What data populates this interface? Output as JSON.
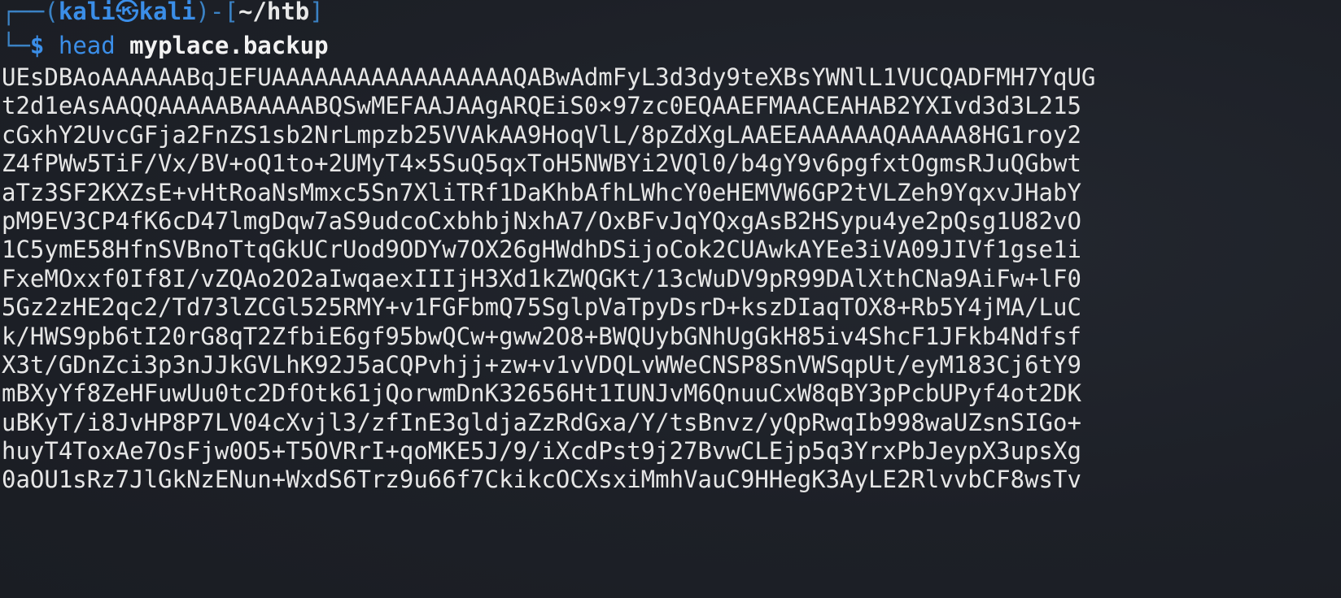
{
  "prompt": {
    "corner_top": "┌──(",
    "user": "kali",
    "at_symbol": "㉿",
    "host": "kali",
    "close_paren_bracket": ")-[",
    "cwd": "~/htb",
    "close_bracket": "]",
    "corner_bottom": "└─",
    "dollar": "$",
    "command": "head",
    "argument": "myplace.backup"
  },
  "output_lines": [
    "UEsDBAoAAAAAABqJEFUAAAAAAAAAAAAAAAAAQABwAdmFyL3d3dy9teXBsYWNlL1VUCQADFMH7YqUG",
    "t2d1eAsAAQQAAAAABAAAAABQSwMEFAAJAAgARQEiS0×97zc0EQAAEFMAACEAHAB2YXIvd3d3L215",
    "cGxhY2UvcGFja2FnZS1sb2NrLmpzb25VVAkAA9HoqVlL/8pZdXgLAAEEAAAAAAQAAAAA8HG1roy2",
    "Z4fPWw5TiF/Vx/BV+oQ1to+2UMyT4×5SuQ5qxToH5NWBYi2VQl0/b4gY9v6pgfxtOgmsRJuQGbwt",
    "aTz3SF2KXZsE+vHtRoaNsMmxc5Sn7XliTRf1DaKhbAfhLWhcY0eHEMVW6GP2tVLZeh9YqxvJHabY",
    "pM9EV3CP4fK6cD47lmgDqw7aS9udcoCxbhbjNxhA7/OxBFvJqYQxgAsB2HSypu4ye2pQsg1U82vO",
    "1C5ymE58HfnSVBnoTtqGkUCrUod9ODYw7OX26gHWdhDSijoCok2CUAwkAYEe3iVA09JIVf1gse1i",
    "FxeMOxxf0If8I/vZQAo2O2aIwqaexIIIjH3Xd1kZWQGKt/13cWuDV9pR99DAlXthCNa9AiFw+lF0",
    "5Gz2zHE2qc2/Td73lZCGl525RMY+v1FGFbmQ75SglpVaTpyDsrD+kszDIaqTOX8+Rb5Y4jMA/LuC",
    "k/HWS9pb6tI20rG8qT2ZfbiE6gf95bwQCw+gww2O8+BWQUybGNhUgGkH85iv4ShcF1JFkb4Ndfsf",
    "X3t/GDnZci3p3nJJkGVLhK92J5aCQPvhjj+zw+v1vVDQLvWWeCNSP8SnVWSqpUt/eyM183Cj6tY9",
    "mBXyYf8ZeHFuwUu0tc2DfOtk61jQorwmDnK32656Ht1IUNJvM6QnuuCxW8qBY3pPcbUPyf4ot2DK",
    "uBKyT/i8JvHP8P7LV04cXvjl3/zfInE3gldjaZzRdGxa/Y/tsBnvz/yQpRwqIb998waUZsnSIGo+",
    "huyT4ToxAe7OsFjw0O5+T5OVRrI+qoMKE5J/9/iXcdPst9j27BvwCLEjp5q3YrxPbJeypX3upsXg",
    "0aOU1sRz7JlGkNzENun+WxdS6Trz9u66f7CkikcOCXsxiMmhVauC9HHegK3AyLE2RlvvbCF8wsTv"
  ]
}
